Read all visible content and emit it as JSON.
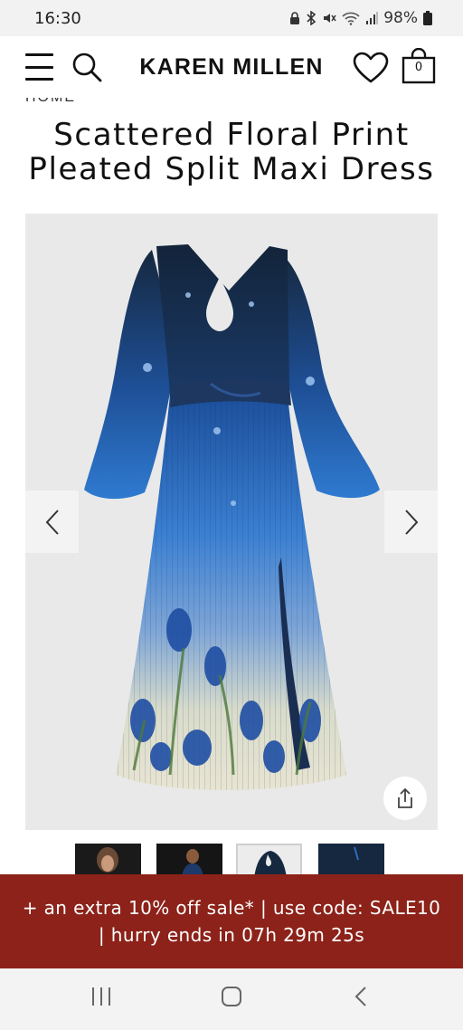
{
  "status_bar": {
    "time": "16:30",
    "battery": "98%",
    "icons": [
      "lock-icon",
      "bluetooth-icon",
      "mute-icon",
      "wifi-icon",
      "signal-icon",
      "battery-icon"
    ]
  },
  "header": {
    "brand": "KAREN MILLEN",
    "bag_count": "0",
    "icons": [
      "hamburger-menu-icon",
      "search-icon",
      "heart-icon",
      "shopping-bag-icon"
    ]
  },
  "breadcrumb": "HOME",
  "product": {
    "title": "Scattered Floral Print Pleated Split Maxi Dress"
  },
  "gallery": {
    "thumbnail_count": 4,
    "active_thumbnail": 3,
    "icons": [
      "chevron-left-icon",
      "chevron-right-icon",
      "share-icon"
    ]
  },
  "promo_banner": {
    "text": "+ an extra 10% off sale* | use code: SALE10 | hurry ends in 07h 29m 25s"
  },
  "system_nav": {
    "icons": [
      "recent-apps-icon",
      "home-icon",
      "back-icon"
    ]
  },
  "colors": {
    "promo_bg": "#8c2219",
    "gallery_bg": "#e9e9e9",
    "dress_navy": "#16283f",
    "dress_blue": "#2e6ec4"
  }
}
